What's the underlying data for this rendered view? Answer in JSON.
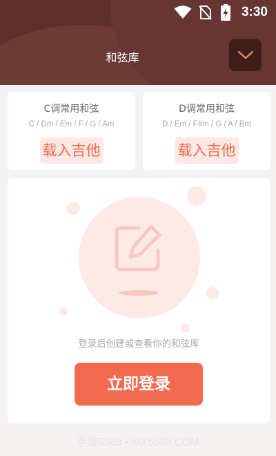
{
  "status_bar": {
    "time": "3:30",
    "icons": [
      "wifi-icon",
      "no-sim-icon",
      "battery-charging-icon"
    ]
  },
  "header": {
    "title": "和弦库",
    "collapse_icon": "chevron-down-icon"
  },
  "presets": [
    {
      "title": "C调常用和弦",
      "chords": "C / Dm / Em / F / G / Am",
      "button": "载入吉他"
    },
    {
      "title": "D调常用和弦",
      "chords": "D / Em / F#m / G / A / Bm",
      "button": "载入吉他"
    }
  ],
  "empty_state": {
    "icon": "edit-note-icon",
    "message": "登录后创建或查看你的和弦库",
    "login_button": "立即登录"
  },
  "watermark": "手游5588 • MX5588.COM",
  "colors": {
    "header_bg": "#5c2f2c",
    "accent": "#f26b50",
    "load_button_bg": "#fde8e3",
    "load_button_text": "#ee6b4f"
  }
}
